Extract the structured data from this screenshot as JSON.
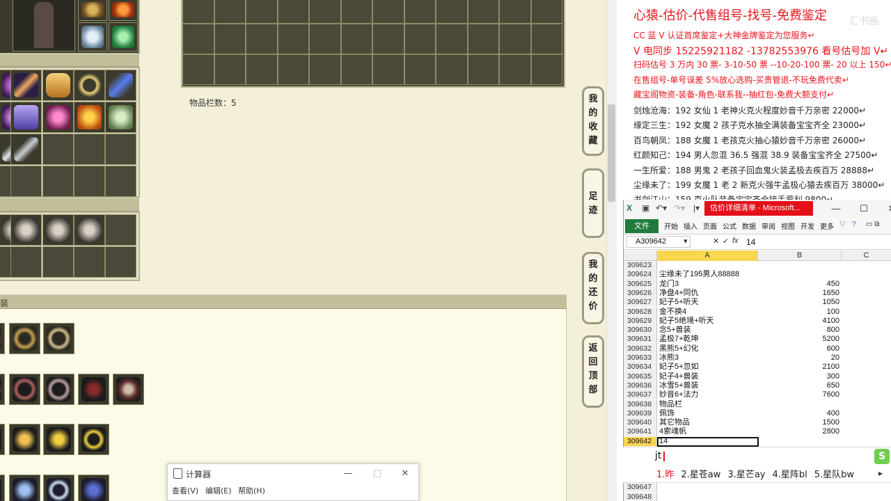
{
  "game": {
    "item_bar_count": "物品栏数：5",
    "side_tabs": [
      {
        "label": "我的收藏"
      },
      {
        "label": "足迹"
      },
      {
        "label": "我的还价"
      },
      {
        "label": "返回顶部"
      }
    ],
    "section_label_fragment": "装"
  },
  "doc": {
    "headline": "心猿-估价-代售组号-找号-免费鉴定",
    "watermark": "汇书画",
    "lines": [
      {
        "text": "CC 蓝 V 认证首席鉴定+大神金牌鉴定为您服务↵",
        "style": "red"
      },
      {
        "text": "V 电同步 15225921182 -13782553976 看号估号加 V↵",
        "style": "red-big"
      },
      {
        "text": "扫码估号 3 万内 30 票- 3-10-50 票 --10-20-100 票- 20 以上 150↵",
        "style": "red"
      },
      {
        "text": "在售组号-单号误差 5%放心选购-买贵管退-不玩免费代卖↵",
        "style": "red"
      },
      {
        "text": "藏宝阁物资-装备-角色-联系我--抽红包-免费大额支付↵",
        "style": "red"
      },
      {
        "text": "剑烛沧海：192 女仙 1 老神火克火程度妙音千万亲密 22000↵",
        "style": "normal"
      },
      {
        "text": "缘定三生：192 女魔 2 孩子克水抽全满装备宝宝齐全 23000↵",
        "style": "normal"
      },
      {
        "text": "百鸟朝凤：188 女魔 1 老孩克火抽心猿妙音千万亲密 26000↵",
        "style": "normal"
      },
      {
        "text": "红颜知己：194 男人忽混 36.5 强混 38.9 装备宝宝齐全 27500↵",
        "style": "normal"
      },
      {
        "text": "一生所爱：188 男鬼 2 老孩子回血鬼火装孟极去疾百万 28888↵",
        "style": "normal"
      },
      {
        "text": "尘缘未了：199 女魔 1 老 2 新克火强牛孟极心猿去疾百万 38000↵",
        "style": "normal"
      },
      {
        "text": "书剑江山：159 克火队装备宝宝齐全接手爱利 9800↵",
        "style": "normal"
      }
    ]
  },
  "excel": {
    "title": "估价详细清单 - Microsoft...",
    "file_tab": "文件",
    "tabs": [
      "开始",
      "插入",
      "页面",
      "公式",
      "数据",
      "审阅",
      "视图",
      "开发",
      "更多"
    ],
    "name_box": "A309642",
    "formula_value": "14",
    "columns": [
      "A",
      "B",
      "C"
    ],
    "rows": [
      {
        "n": "309623",
        "a": "",
        "b": ""
      },
      {
        "n": "309624",
        "a": "尘缘未了195男人88888",
        "b": ""
      },
      {
        "n": "309625",
        "a": "龙门3",
        "b": "450"
      },
      {
        "n": "309626",
        "a": "净盘4+同仇",
        "b": "1650"
      },
      {
        "n": "309627",
        "a": "妃子5+听天",
        "b": "1050"
      },
      {
        "n": "309628",
        "a": "金不换4",
        "b": "100"
      },
      {
        "n": "309629",
        "a": "妃子5绝境+听天",
        "b": "4100"
      },
      {
        "n": "309630",
        "a": "念5+兽装",
        "b": "800"
      },
      {
        "n": "309631",
        "a": "孟极7+乾坤",
        "b": "5200"
      },
      {
        "n": "309632",
        "a": "黑熊5+幻化",
        "b": "600"
      },
      {
        "n": "309633",
        "a": "冰熊3",
        "b": "20"
      },
      {
        "n": "309634",
        "a": "妃子5+忽如",
        "b": "2100"
      },
      {
        "n": "309635",
        "a": "妃子4+兽装",
        "b": "300"
      },
      {
        "n": "309636",
        "a": "冰雪5+兽装",
        "b": "650"
      },
      {
        "n": "309637",
        "a": "妙音6+法力",
        "b": "7600"
      },
      {
        "n": "309638",
        "a": "物品栏",
        "b": ""
      },
      {
        "n": "309639",
        "a": "佩饰",
        "b": "400"
      },
      {
        "n": "309640",
        "a": "其它物品",
        "b": "1500"
      },
      {
        "n": "309641",
        "a": "4索魂帆",
        "b": "2800"
      },
      {
        "n": "309642",
        "a": "14",
        "b": ""
      }
    ],
    "tail_rows": [
      "30964",
      "30964",
      "30964",
      "30964",
      "309647",
      "309648"
    ]
  },
  "ime": {
    "input": "jt",
    "candidates": [
      "1.昨",
      "2.星苍aw",
      "3.星芒ay",
      "4.星阵bl",
      "5.星队bw"
    ]
  },
  "calculator": {
    "title": "计算器",
    "menu": [
      "查看(V)",
      "编辑(E)",
      "帮助(H)"
    ],
    "minimize": "—",
    "maximize": "□",
    "close": "✕"
  },
  "colors": {
    "game_bg": "#f3efd9",
    "slot_bg": "#4a4838",
    "ad_red": "#e8151d",
    "excel_green": "#1f7a3c",
    "excel_active_row": "#f8d64e"
  }
}
